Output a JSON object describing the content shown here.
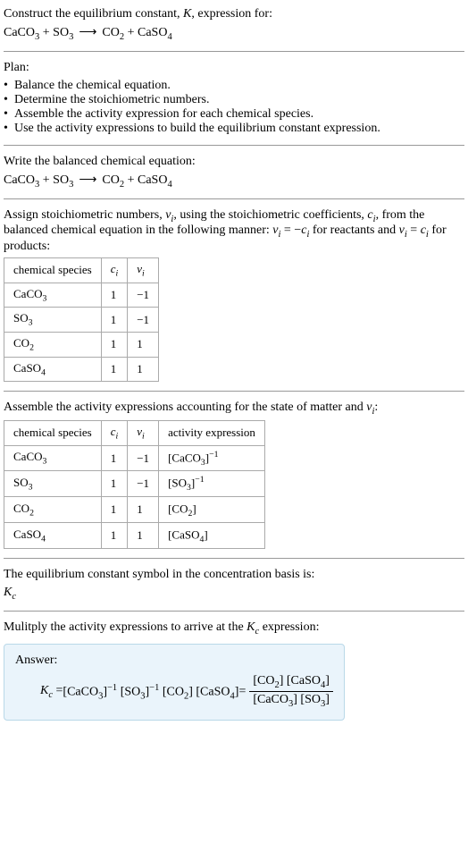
{
  "intro": {
    "line1_prefix": "Construct the equilibrium constant, ",
    "K": "K",
    "line1_suffix": ", expression for:"
  },
  "reaction": {
    "r1": "CaCO",
    "r1sub": "3",
    "plus1": " + ",
    "r2": "SO",
    "r2sub": "3",
    "arrow": "⟶",
    "p1": "CO",
    "p1sub": "2",
    "plus2": " + ",
    "p2": "CaSO",
    "p2sub": "4"
  },
  "plan": {
    "heading": "Plan:",
    "bullets": [
      "Balance the chemical equation.",
      "Determine the stoichiometric numbers.",
      "Assemble the activity expression for each chemical species.",
      "Use the activity expressions to build the equilibrium constant expression."
    ]
  },
  "balanced": {
    "heading": "Write the balanced chemical equation:"
  },
  "stoich": {
    "line_a": "Assign stoichiometric numbers, ",
    "nu": "ν",
    "i": "i",
    "line_b": ", using the stoichiometric coefficients, ",
    "c": "c",
    "line_c": ", from the balanced chemical equation in the following manner: ",
    "eq1_lhs": "ν",
    "eq1_sub": "i",
    "eq1_mid": " = −",
    "eq1_rhs": "c",
    "eq1_rsub": "i",
    "line_d": " for reactants and ",
    "eq2_lhs": "ν",
    "eq2_sub": "i",
    "eq2_mid": " = ",
    "eq2_rhs": "c",
    "eq2_rsub": "i",
    "line_e": " for products:"
  },
  "table1": {
    "headers": {
      "species": "chemical species",
      "c": "c",
      "ci": "i",
      "nu": "ν",
      "nui": "i"
    },
    "rows": [
      {
        "sp": "CaCO",
        "spsub": "3",
        "c": "1",
        "nu": "−1"
      },
      {
        "sp": "SO",
        "spsub": "3",
        "c": "1",
        "nu": "−1"
      },
      {
        "sp": "CO",
        "spsub": "2",
        "c": "1",
        "nu": "1"
      },
      {
        "sp": "CaSO",
        "spsub": "4",
        "c": "1",
        "nu": "1"
      }
    ]
  },
  "activity": {
    "line_a": "Assemble the activity expressions accounting for the state of matter and ",
    "nu": "ν",
    "i": "i",
    "colon": ":"
  },
  "table2": {
    "headers": {
      "species": "chemical species",
      "c": "c",
      "ci": "i",
      "nu": "ν",
      "nui": "i",
      "act": "activity expression"
    },
    "rows": [
      {
        "sp": "CaCO",
        "spsub": "3",
        "c": "1",
        "nu": "−1",
        "act_l": "[CaCO",
        "act_sub": "3",
        "act_r": "]",
        "act_exp": "−1"
      },
      {
        "sp": "SO",
        "spsub": "3",
        "c": "1",
        "nu": "−1",
        "act_l": "[SO",
        "act_sub": "3",
        "act_r": "]",
        "act_exp": "−1"
      },
      {
        "sp": "CO",
        "spsub": "2",
        "c": "1",
        "nu": "1",
        "act_l": "[CO",
        "act_sub": "2",
        "act_r": "]",
        "act_exp": ""
      },
      {
        "sp": "CaSO",
        "spsub": "4",
        "c": "1",
        "nu": "1",
        "act_l": "[CaSO",
        "act_sub": "4",
        "act_r": "]",
        "act_exp": ""
      }
    ]
  },
  "symbol": {
    "line": "The equilibrium constant symbol in the concentration basis is:",
    "K": "K",
    "c": "c"
  },
  "multiply": {
    "line_a": "Mulitply the activity expressions to arrive at the ",
    "K": "K",
    "c": "c",
    "line_b": " expression:"
  },
  "answer": {
    "label": "Answer:",
    "K": "K",
    "c": "c",
    "eq": " = ",
    "t1": "[CaCO",
    "t1s": "3",
    "t1r": "]",
    "t1e": "−1",
    "t2": " [SO",
    "t2s": "3",
    "t2r": "]",
    "t2e": "−1",
    "t3": " [CO",
    "t3s": "2",
    "t3r": "]",
    "t4": " [CaSO",
    "t4s": "4",
    "t4r": "]",
    "eq2": " = ",
    "num_a": "[CO",
    "num_as": "2",
    "num_ar": "] [CaSO",
    "num_bs": "4",
    "num_br": "]",
    "den_a": "[CaCO",
    "den_as": "3",
    "den_ar": "] [SO",
    "den_bs": "3",
    "den_br": "]"
  }
}
